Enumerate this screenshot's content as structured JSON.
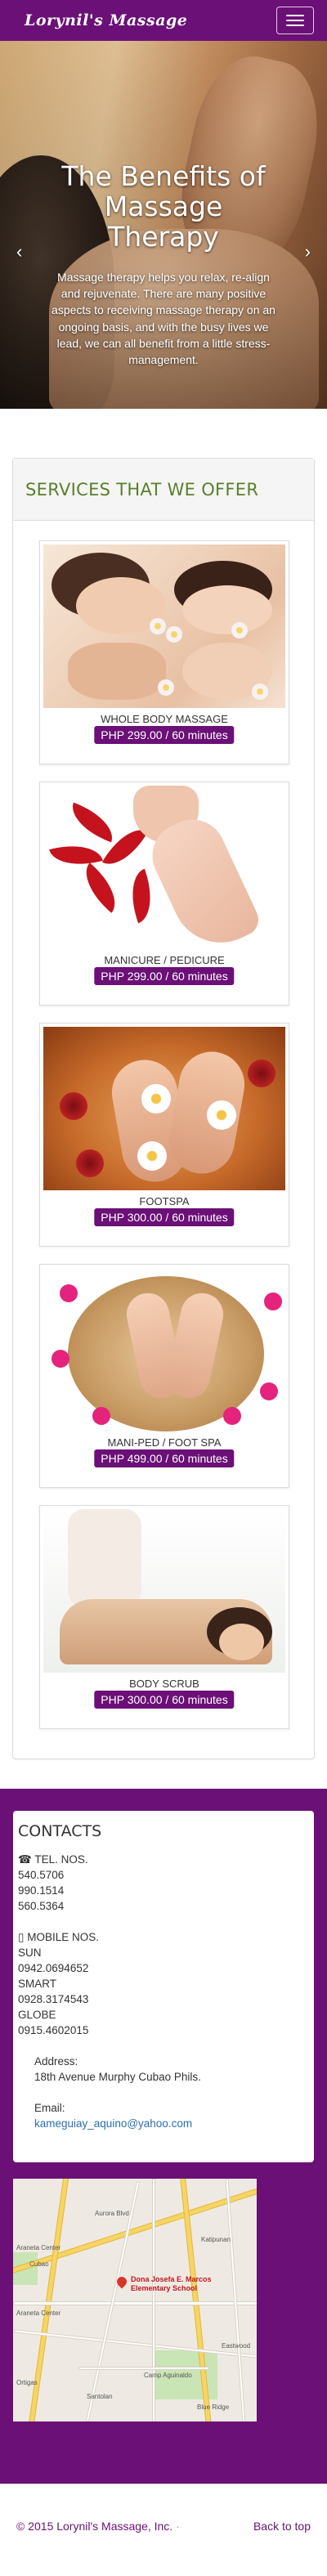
{
  "navbar": {
    "brand": "Lorynil's Massage"
  },
  "hero": {
    "title": "The Benefits of Massage Therapy",
    "text": "Massage therapy helps you relax, re-align and rejuvenate. There are many positive aspects to receiving massage therapy on an ongoing basis, and with the busy lives we lead, we can all benefit from a little stress-management.",
    "prev_icon": "‹",
    "next_icon": "›",
    "slide_count": 3,
    "active_slide": 1
  },
  "services": {
    "heading": "SERVICES THAT WE OFFER",
    "items": [
      {
        "name": "WHOLE BODY MASSAGE",
        "price": "PHP 299.00 / 60 minutes"
      },
      {
        "name": "MANICURE / PEDICURE",
        "price": "PHP 299.00 / 60 minutes"
      },
      {
        "name": "FOOTSPA",
        "price": "PHP 300.00 / 60 minutes"
      },
      {
        "name": "MANI-PED / FOOT SPA",
        "price": "PHP 499.00 / 60 minutes"
      },
      {
        "name": "BODY SCRUB",
        "price": "PHP 300.00 / 60 minutes"
      }
    ]
  },
  "contacts": {
    "heading": "CONTACTS",
    "tel_label": "TEL. NOS.",
    "tel_numbers": [
      "540.5706",
      "990.1514",
      "560.5364"
    ],
    "mobile_label": "MOBILE NOS.",
    "sun_label": "SUN",
    "sun_number": "0942.0694652",
    "smart_label": "SMART",
    "smart_number": "0928.3174543",
    "globe_label": "GLOBE",
    "globe_number": "0915.4602015",
    "address_label": "Address:",
    "address": "18th Avenue Murphy Cubao Phils.",
    "email_label": "Email:",
    "email": "kameguiay_aquino@yahoo.com"
  },
  "map": {
    "pin_label_1": "Dona Josefa E. Marcos",
    "pin_label_2": "Elementary School",
    "labels": [
      "Aurora Blvd",
      "Araneta Center",
      "Cubao",
      "Araneta Center",
      "Santolan",
      "Katipunan",
      "Camp Aguinaldo",
      "Ortigas",
      "Eastwood",
      "Blue Ridge"
    ]
  },
  "footer": {
    "copyright": "© 2015 Lorynil's Massage, Inc.",
    "separator": "·",
    "back_to_top": "Back to top"
  },
  "colors": {
    "brand_purple": "#6b1077",
    "heading_green": "#5a7f2a",
    "link_blue": "#2a6fb0"
  }
}
